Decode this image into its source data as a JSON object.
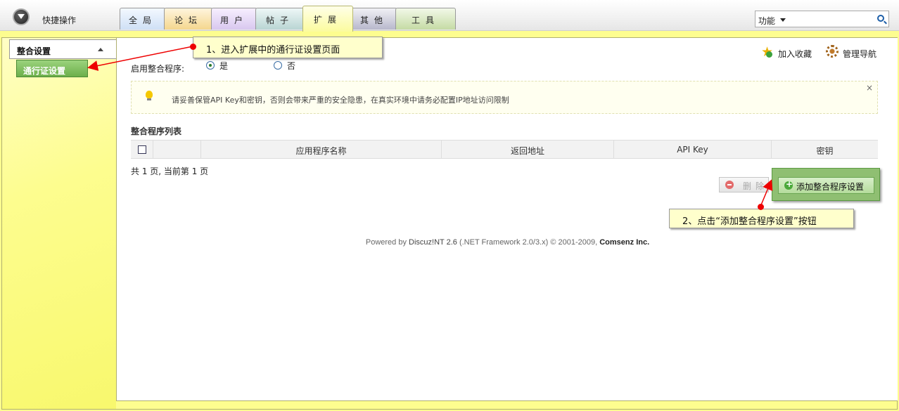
{
  "header": {
    "quick_ops_label": "快捷操作",
    "tabs": [
      "全局",
      "论坛",
      "用户",
      "帖子",
      "扩展",
      "其他",
      "工具"
    ],
    "active_tab_index": 4,
    "function_select": "功能"
  },
  "sidebar": {
    "section_title": "整合设置",
    "items": [
      {
        "label": "通行证设置",
        "active": true
      }
    ]
  },
  "toolbar": {
    "add_favorite": "加入收藏",
    "manage_nav": "管理导航"
  },
  "form": {
    "enable_label": "启用整合程序:",
    "options": [
      {
        "label": "是",
        "checked": true
      },
      {
        "label": "否",
        "checked": false
      }
    ]
  },
  "notice": {
    "text": "请妥善保管API Key和密钥，否则会带来严重的安全隐患，在真实环境中请务必配置IP地址访问限制",
    "close": "×"
  },
  "list": {
    "title": "整合程序列表",
    "columns": [
      "",
      "",
      "应用程序名称",
      "返回地址",
      "API Key",
      "密钥"
    ],
    "rows": [],
    "pager": "共 1 页, 当前第 1 页"
  },
  "buttons": {
    "delete": "删除",
    "add": "添加整合程序设置"
  },
  "footer": {
    "powered": "Powered by",
    "product": "Discuz!NT 2.6",
    "framework": "(.NET Framework 2.0/3.x)",
    "copyright": "© 2001-2009,",
    "company": "Comsenz Inc."
  },
  "annotations": {
    "step1": "1、进入扩展中的通行证设置页面",
    "step2": "2、点击“添加整合程序设置”按钮"
  },
  "colors": {
    "frame": "#fdfd8f",
    "sidebar_active": "#7dbf5a",
    "annotation_bg": "#ffffcc",
    "annotation_arrow": "#ee0000"
  }
}
